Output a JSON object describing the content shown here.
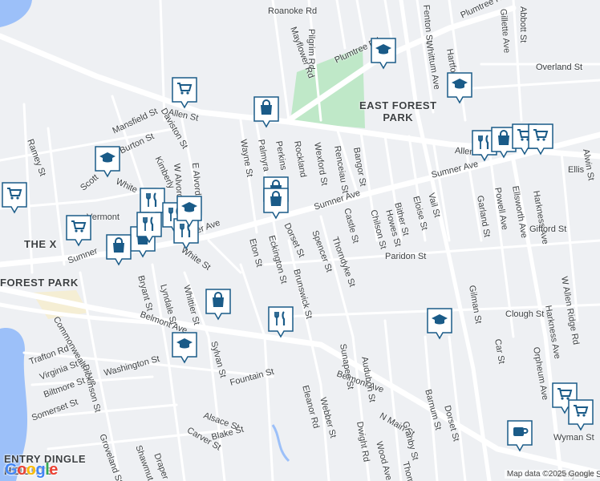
{
  "attribution": "Map data ©2025 Google",
  "logo": {
    "letters": [
      "G",
      "o",
      "o",
      "g",
      "l",
      "e"
    ],
    "colors": [
      "#4285F4",
      "#EA4335",
      "#FBBC05",
      "#4285F4",
      "#34A853",
      "#EA4335"
    ]
  },
  "colors": {
    "land": "#eef0f3",
    "road": "#ffffff",
    "road_major": "#ffffff",
    "park": "#bfe8c8",
    "water": "#9cc0f9",
    "pin": "#1a5b88"
  },
  "areas": [
    {
      "id": "east-forest-park",
      "text": "EAST FOREST\nPARK"
    },
    {
      "id": "the-x",
      "text": "THE X"
    },
    {
      "id": "forest-park",
      "text": "FOREST PARK"
    },
    {
      "id": "entry-dingle",
      "text": "ENTRY DINGLE\nHEIGHTS"
    }
  ],
  "streets": [
    "Roanoke Rd",
    "Pilgrim Rd",
    "Mayflower Rd",
    "Plumtree Rd",
    "Plumtree Rd",
    "Abbott St",
    "Overland St",
    "Gillette Ave",
    "Hartford Te",
    "Whittum Ave",
    "Allen St",
    "Allen St",
    "Daviston St",
    "Mansfield St",
    "Burton St",
    "Ramey St",
    "Kimberly",
    "W Alvord",
    "E Alvord",
    "Wayne St",
    "Palmyra",
    "Perkins",
    "Rockland",
    "Wexford St",
    "Renceiau St",
    "Bangor St",
    "Sumner Ave",
    "Sumner Ave",
    "Sumner Ave",
    "Vermont",
    "Scott",
    "White",
    "White St",
    "Eton St",
    "Eckington St",
    "Dorset St",
    "Spencer St",
    "Thorndyke St",
    "Castle St",
    "Chilson St",
    "Howes St",
    "Bither St",
    "Eloise St",
    "Vail St",
    "Garland St",
    "Powell Ave",
    "Ellsworth Ave",
    "Harkness Ave",
    "Harkness Ave",
    "Gifford St",
    "W Allen Ridge Rd",
    "Paridon St",
    "Gilman St",
    "Clough St",
    "Car St",
    "Orpheum Ave",
    "Brunswick St",
    "Bryant St",
    "Lyndale St",
    "Whittier St",
    "Belmont Ave",
    "Belmont Ave",
    "Commonwealth Ave",
    "Trafton Rd",
    "Virginia St",
    "Washington St",
    "Biltmore St",
    "Somerset St",
    "Dickinson St",
    "Groveland St",
    "Shawmut St",
    "Draper St",
    "Sylvan St",
    "Alsace St",
    "Carver St",
    "Blake St",
    "Fountain St",
    "Eleanor Rd",
    "Webber St",
    "Sunapee St",
    "Audubon St",
    "Dwight Rd",
    "N Main St",
    "Wood Ave",
    "Granby St",
    "Thompson",
    "Barnum St",
    "Dorset St",
    "Benjamin St",
    "Wyman St",
    "Fenton St",
    "Ellis",
    "Sumner",
    "Alwin St"
  ],
  "pins": [
    {
      "type": "cart-icon"
    },
    {
      "type": "grad-cap-icon"
    },
    {
      "type": "bag-icon"
    },
    {
      "type": "grad-cap-icon"
    },
    {
      "type": "grad-cap-icon"
    },
    {
      "type": "fork-knife-icon"
    },
    {
      "type": "cart-icon"
    },
    {
      "type": "fork-knife-icon"
    },
    {
      "type": "fork-knife-icon"
    },
    {
      "type": "cart-icon"
    },
    {
      "type": "bag-icon"
    },
    {
      "type": "bag-icon"
    },
    {
      "type": "grad-cap-icon"
    },
    {
      "type": "fork-knife-icon"
    },
    {
      "type": "bag-icon"
    },
    {
      "type": "bag-icon"
    },
    {
      "type": "grad-cap-icon"
    },
    {
      "type": "fork-knife-icon"
    },
    {
      "type": "bag-icon"
    },
    {
      "type": "grad-cap-icon"
    },
    {
      "type": "fork-knife-icon"
    },
    {
      "type": "bag-icon"
    },
    {
      "type": "cart-icon"
    },
    {
      "type": "cart-icon"
    },
    {
      "type": "cart-icon"
    },
    {
      "type": "coffee-icon"
    },
    {
      "type": "cart-icon"
    }
  ]
}
